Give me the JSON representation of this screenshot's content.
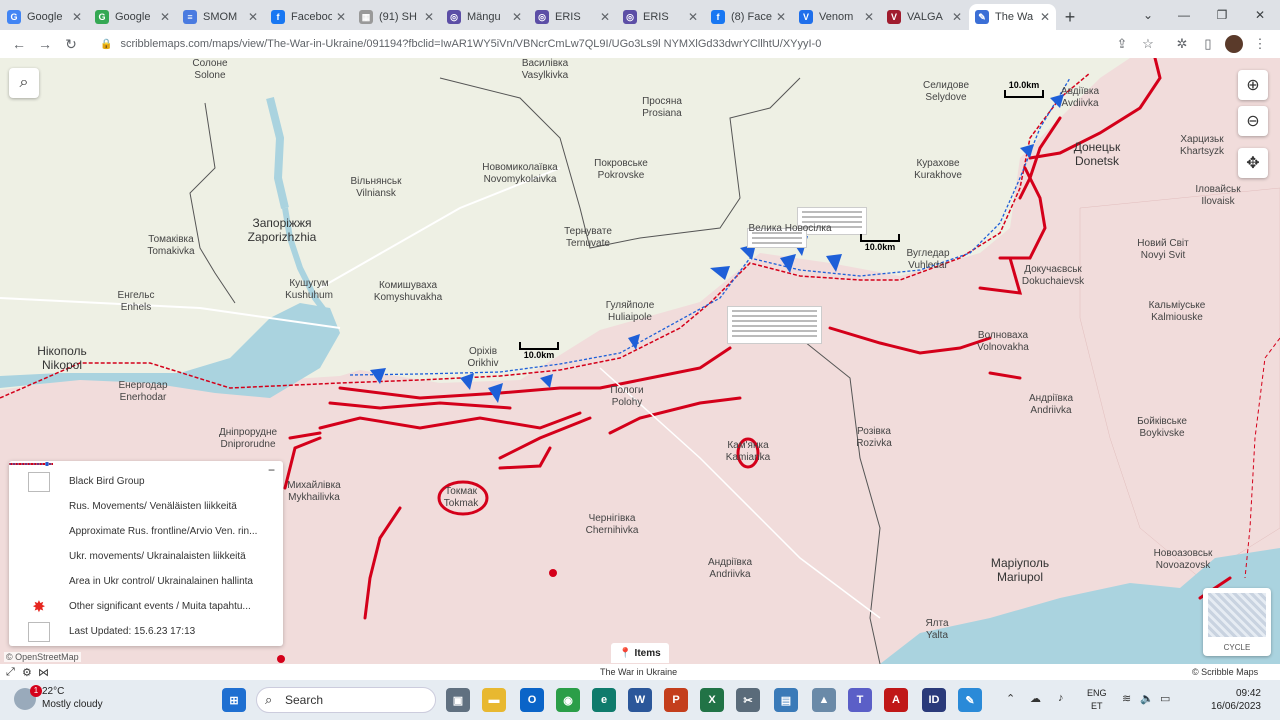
{
  "browser": {
    "tabs": [
      {
        "label": "Google",
        "color": "#4285f4",
        "glyph": "G"
      },
      {
        "label": "Google",
        "color": "#34a853",
        "glyph": "G"
      },
      {
        "label": "SMOM",
        "color": "#4a7be0",
        "glyph": "≡"
      },
      {
        "label": "Faceboo",
        "color": "#1877f2",
        "glyph": "f"
      },
      {
        "label": "(91) SH",
        "color": "#999999",
        "glyph": "▦"
      },
      {
        "label": "Mängu",
        "color": "#5c4ea6",
        "glyph": "◎"
      },
      {
        "label": "ERIS",
        "color": "#5c4ea6",
        "glyph": "◎"
      },
      {
        "label": "ERIS",
        "color": "#5c4ea6",
        "glyph": "◎"
      },
      {
        "label": "(8) Face",
        "color": "#1877f2",
        "glyph": "f"
      },
      {
        "label": "Venom",
        "color": "#1f6feb",
        "glyph": "V"
      },
      {
        "label": "VALGA",
        "color": "#a01c2e",
        "glyph": "V"
      },
      {
        "label": "The Wa",
        "color": "#3b6fd6",
        "glyph": "✎",
        "active": true
      }
    ],
    "new_tab": "+",
    "address": "scribblemaps.com/maps/view/The-War-in-Ukraine/091194?fbclid=IwAR1WY5iVn/VBNcrCmLw7QL9I/UGo3Ls9l NYMXlGd33dwrYCllhtU/XYyyI-0",
    "window_controls": [
      "⌄",
      "—",
      "❐",
      "✕"
    ]
  },
  "map": {
    "places": [
      {
        "uk": "Солоне",
        "en": "Solone"
      },
      {
        "uk": "Василівка",
        "en": "Vasylkivka"
      },
      {
        "uk": "Просяна",
        "en": "Prosiana"
      },
      {
        "uk": "Селидове",
        "en": "Selydove"
      },
      {
        "uk": "Авдіївка",
        "en": "Avdiivka"
      },
      {
        "uk": "Донецьк",
        "en": "Donetsk",
        "big": true
      },
      {
        "uk": "Харцизьк",
        "en": "Khartsyzk"
      },
      {
        "uk": "Новомиколаївка",
        "en": "Novomykolaivka"
      },
      {
        "uk": "Покровське",
        "en": "Pokrovske"
      },
      {
        "uk": "Курахове",
        "en": "Kurakhove"
      },
      {
        "uk": "Вільнянськ",
        "en": "Vilniansk"
      },
      {
        "uk": "Запоріжжя",
        "en": "Zaporizhzhia",
        "big": true
      },
      {
        "uk": "Іловайськ",
        "en": "Ilovaisk"
      },
      {
        "uk": "Тернувате",
        "en": "Ternuvate"
      },
      {
        "uk": "Велика Новосілка",
        "en": ""
      },
      {
        "uk": "Вугледар",
        "en": "Vuhledar"
      },
      {
        "uk": "Новий Світ",
        "en": "Novyi Svit"
      },
      {
        "uk": "Томаківка",
        "en": "Tomakivka"
      },
      {
        "uk": "Кушугум",
        "en": "Kushuhum"
      },
      {
        "uk": "Комишуваха",
        "en": "Komyshuvakha"
      },
      {
        "uk": "Докучаєвськ",
        "en": "Dokuchaievsk"
      },
      {
        "uk": "Енгельс",
        "en": "Enhels"
      },
      {
        "uk": "Гуляйполе",
        "en": "Huliaipole"
      },
      {
        "uk": "Кальміуське",
        "en": "Kalmiouske"
      },
      {
        "uk": "Нікополь",
        "en": "Nikopol",
        "big": true
      },
      {
        "uk": "Оріхів",
        "en": "Orikhiv"
      },
      {
        "uk": "Волноваха",
        "en": "Volnovakha"
      },
      {
        "uk": "Енергодар",
        "en": "Enerhodar"
      },
      {
        "uk": "Пологи",
        "en": "Polohy"
      },
      {
        "uk": "Андріївка",
        "en": "Andriivka"
      },
      {
        "uk": "Дніпрорудне",
        "en": "Dniprorudne"
      },
      {
        "uk": "Бойківське",
        "en": "Boykivske"
      },
      {
        "uk": "Розівка",
        "en": "Rozivka"
      },
      {
        "uk": "Кам'янка",
        "en": "Kamianka"
      },
      {
        "uk": "Михайлівка",
        "en": "Mykhailivka"
      },
      {
        "uk": "Токмак",
        "en": "Tokmak"
      },
      {
        "uk": "Чернігівка",
        "en": "Chernihivka"
      },
      {
        "uk": "Новоазовськ",
        "en": "Novoazovsk"
      },
      {
        "uk": "Андріївка",
        "en": "Andriivka"
      },
      {
        "uk": "Маріуполь",
        "en": "Mariupol",
        "big": true
      },
      {
        "uk": "Ялта",
        "en": "Yalta"
      }
    ],
    "scalebars": [
      "10.0km",
      "10.0km",
      "10.0km"
    ],
    "buttons": {
      "search": "⌕",
      "zoom_in": "⊕",
      "zoom_out": "⊖",
      "locate": "✥"
    },
    "colors": {
      "occupied": "#f1d9d9",
      "free": "#eef0e4",
      "water": "#aad3df",
      "rus": "#d4001a",
      "ukr": "#1e5fd8"
    }
  },
  "legend": {
    "minimize": "−",
    "rows": [
      {
        "type": "box",
        "label": "Black Bird Group"
      },
      {
        "type": "rusline",
        "label": "Rus. Movements/ Venäläisten liikkeitä"
      },
      {
        "type": "rusdash",
        "label": "Approximate Rus. frontline/Arvio Ven. rin..."
      },
      {
        "type": "ukrline",
        "label": "Ukr. movements/ Ukrainalaisten liikkeitä"
      },
      {
        "type": "thin",
        "label": "Area in Ukr control/ Ukrainalainen hallinta"
      },
      {
        "type": "burst",
        "label": "Other significant events / Muita tapahtu..."
      },
      {
        "type": "box",
        "label": "Last Updated: 15.6.23 17:13"
      }
    ]
  },
  "footer": {
    "osm": "© OpenStreetMap",
    "items": "Items",
    "title": "The War in Ukraine",
    "credit": "© Scribble Maps",
    "cycle": "CYCLE"
  },
  "taskbar": {
    "temp": "22°C",
    "weather": "Mostly cloudy",
    "badge": "1",
    "search": "Search",
    "lang1": "ENG",
    "lang2": "ET",
    "time": "09:42",
    "date": "16/06/2023"
  }
}
